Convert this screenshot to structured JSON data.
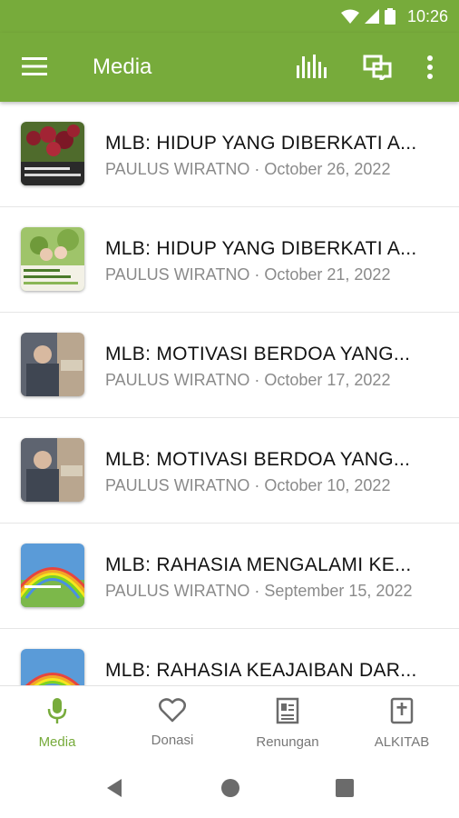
{
  "statusbar": {
    "time": "10:26"
  },
  "appbar": {
    "title": "Media",
    "icons": [
      "menu-icon",
      "equalizer-icon",
      "chat-icon",
      "more-vert-icon"
    ],
    "color": "#77ab3b"
  },
  "items": [
    {
      "title": "MLB: HIDUP YANG DIBERKATI A...",
      "author": "PAULUS WIRATNO",
      "date": "October 26, 2022",
      "thumb": "grapes"
    },
    {
      "title": "MLB: HIDUP YANG DIBERKATI A...",
      "author": "PAULUS WIRATNO",
      "date": "October 21, 2022",
      "thumb": "family"
    },
    {
      "title": "MLB: MOTIVASI BERDOA YANG...",
      "author": "PAULUS WIRATNO",
      "date": "October 17, 2022",
      "thumb": "praying-man"
    },
    {
      "title": "MLB: MOTIVASI BERDOA YANG...",
      "author": "PAULUS WIRATNO",
      "date": "October 10, 2022",
      "thumb": "praying-man"
    },
    {
      "title": "MLB: RAHASIA MENGALAMI KE...",
      "author": "PAULUS WIRATNO",
      "date": "September 15, 2022",
      "thumb": "rainbow"
    },
    {
      "title": "MLB: RAHASIA KEAJAIBAN DAR...",
      "author": "",
      "date": "",
      "thumb": "rainbow"
    }
  ],
  "separator": " · ",
  "bottomnav": [
    {
      "label": "Media",
      "icon": "microphone-icon",
      "active": true
    },
    {
      "label": "Donasi",
      "icon": "heart-icon",
      "active": false
    },
    {
      "label": "Renungan",
      "icon": "newspaper-icon",
      "active": false
    },
    {
      "label": "ALKITAB",
      "icon": "bible-icon",
      "active": false
    }
  ],
  "colors": {
    "accent": "#77ab3b",
    "meta": "#8a8a8a",
    "title": "#111111"
  }
}
